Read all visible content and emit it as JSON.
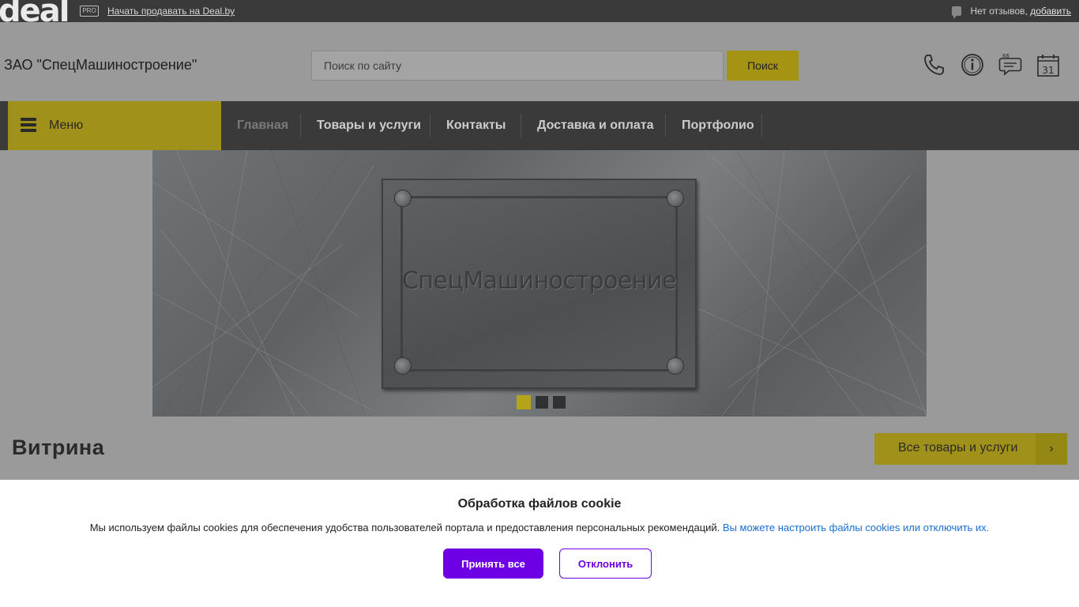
{
  "topbar": {
    "logo": "deal",
    "pro_badge": "PRO",
    "sell_link": "Начать продавать на Deal.by",
    "reviews_text": "Нет отзывов,",
    "reviews_add": "добавить"
  },
  "header": {
    "company_name": "ЗАО \"СпецМашиностроение\"",
    "search_placeholder": "Поиск по сайту",
    "search_value": "",
    "search_button": "Поиск",
    "calendar_day": "31"
  },
  "nav": {
    "menu_label": "Меню",
    "items": [
      {
        "label": "Главная",
        "active": true
      },
      {
        "label": "Товары и услуги",
        "active": false
      },
      {
        "label": "Контакты",
        "active": false
      },
      {
        "label": "Доставка и оплата",
        "active": false
      },
      {
        "label": "Портфолио",
        "active": false
      }
    ]
  },
  "banner": {
    "plate_text": "СпецМашиностроение",
    "slides_count": 3,
    "active_slide": 1
  },
  "showcase": {
    "title": "Витрина",
    "all_goods_button": "Все товары и услуги"
  },
  "cookie": {
    "title": "Обработка файлов cookie",
    "text": "Мы используем файлы cookies для обеспечения удобства пользователей портала и предоставления персональных рекомендаций.",
    "link": "Вы можете настроить файлы cookies или отключить их.",
    "accept": "Принять все",
    "decline": "Отклонить"
  },
  "colors": {
    "accent_yellow": "#a0911a",
    "nav_bg": "#3a3a3a",
    "cookie_purple": "#6e00e6",
    "link_blue": "#1a6fd1"
  },
  "icons": [
    "phone-icon",
    "info-icon",
    "review-chat-icon",
    "calendar-icon",
    "burger-icon",
    "chevron-right-icon",
    "chat-bubble-icon"
  ]
}
